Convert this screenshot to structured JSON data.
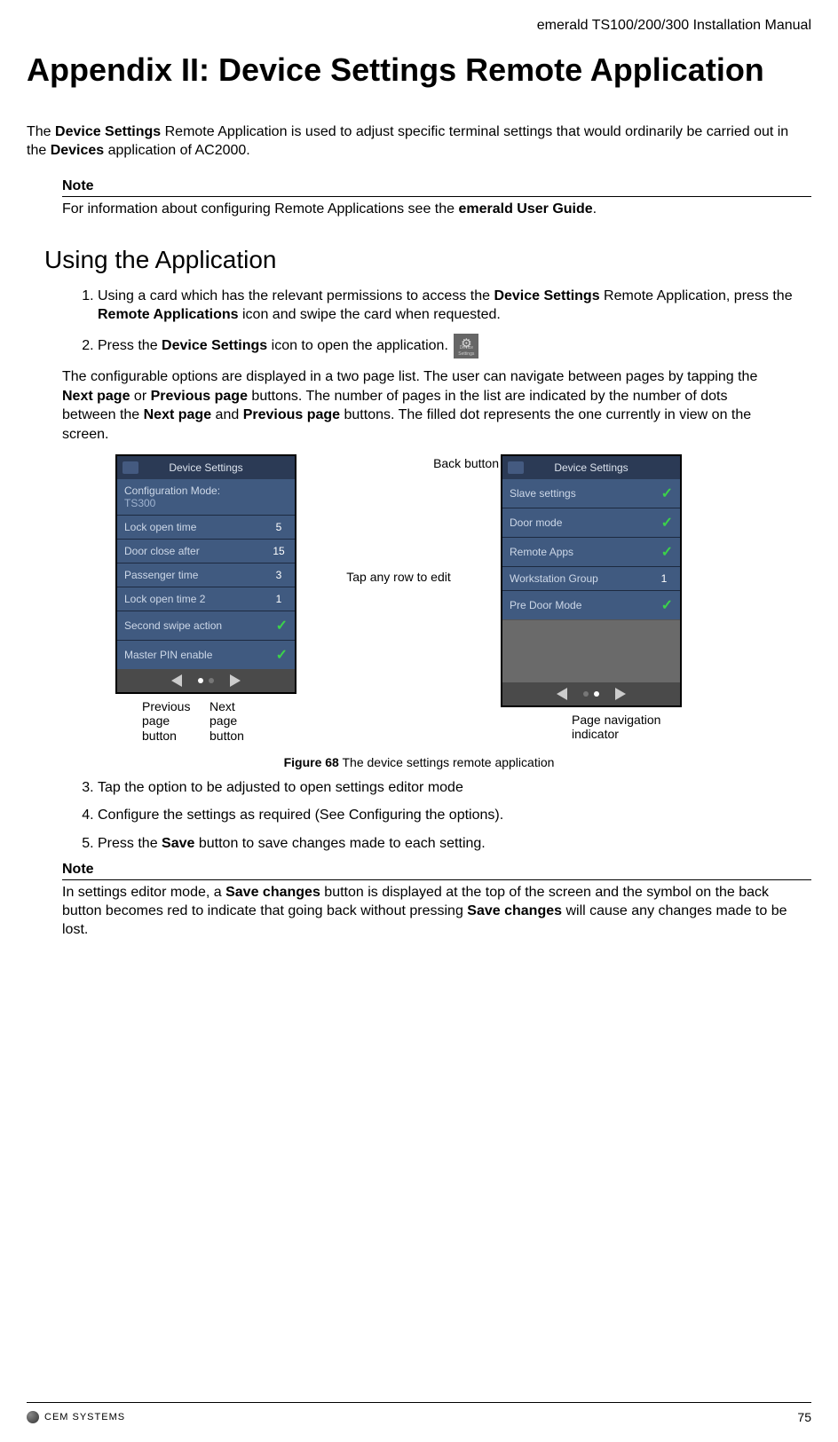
{
  "header": {
    "doc_title": "emerald TS100/200/300 Installation Manual"
  },
  "title": "Appendix II:  Device Settings Remote Application",
  "intro": {
    "t1": "The ",
    "b1": "Device Settings",
    "t2": " Remote Application is used to adjust specific terminal settings that would ordinarily be carried out in the ",
    "b2": "Devices",
    "t3": " application of AC2000."
  },
  "note1": {
    "heading": "Note",
    "t1": "For information about configuring Remote Applications see the ",
    "b1": "emerald User Guide",
    "t2": "."
  },
  "section_heading": "Using the Application",
  "step1": {
    "t1": "Using a card which has the relevant permissions to access the ",
    "b1": "Device Settings",
    "t2": " Remote Application, press the ",
    "b2": "Remote Applications",
    "t3": " icon and swipe the card when requested."
  },
  "step2": {
    "t1": "Press the ",
    "b1": "Device Settings",
    "t2": " icon to open the application."
  },
  "para_config": {
    "t1": "The configurable options are displayed in a two page list. The user can navigate between pages by tapping the ",
    "b1": "Next page",
    "t2": " or ",
    "b2": "Previous page",
    "t3": " buttons. The number of pages in the list are indicated by the number of dots between the ",
    "b3": "Next page",
    "t4": " and ",
    "b4": "Previous page",
    "t5": " buttons. The filled dot represents the one currently in view on the screen."
  },
  "figure": {
    "left_header": "Device Settings",
    "right_header": "Device Settings",
    "left_rows": [
      {
        "label": "Configuration Mode:",
        "sub": "TS300",
        "value": ""
      },
      {
        "label": "Lock open time",
        "value": "5"
      },
      {
        "label": "Door close after",
        "value": "15"
      },
      {
        "label": "Passenger time",
        "value": "3"
      },
      {
        "label": "Lock open time 2",
        "value": "1"
      },
      {
        "label": "Second swipe action",
        "value": "✓"
      },
      {
        "label": "Master PIN enable",
        "value": "✓"
      }
    ],
    "right_rows": [
      {
        "label": "Slave settings",
        "value": "✓"
      },
      {
        "label": "Door mode",
        "value": "✓"
      },
      {
        "label": "Remote Apps",
        "value": "✓"
      },
      {
        "label": "Workstation Group",
        "value": "1"
      },
      {
        "label": "Pre Door Mode",
        "value": "✓"
      }
    ],
    "annot_back": "Back button",
    "annot_tap": "Tap any row to edit",
    "below_left": {
      "prev": "Previous page button",
      "next": "Next page button"
    },
    "below_right": "Page navigation indicator",
    "caption_label": "Figure 68",
    "caption_text": " The device settings remote application"
  },
  "step3": "Tap the option to be adjusted to open settings editor mode",
  "step4": "Configure the settings as required (See Configuring the options).",
  "step5": {
    "t1": "Press the ",
    "b1": "Save",
    "t2": " button to save changes made to each setting."
  },
  "note2": {
    "heading": "Note",
    "t1": "In settings editor mode, a ",
    "b1": "Save changes",
    "t2": " button is displayed at the top of the screen and the symbol on the back button becomes red to indicate that going back without pressing ",
    "b2": "Save changes",
    "t3": " will cause any changes made to be lost."
  },
  "footer": {
    "logo_text": "CEM SYSTEMS",
    "page_num": "75"
  },
  "icon_label": "Device Settings"
}
